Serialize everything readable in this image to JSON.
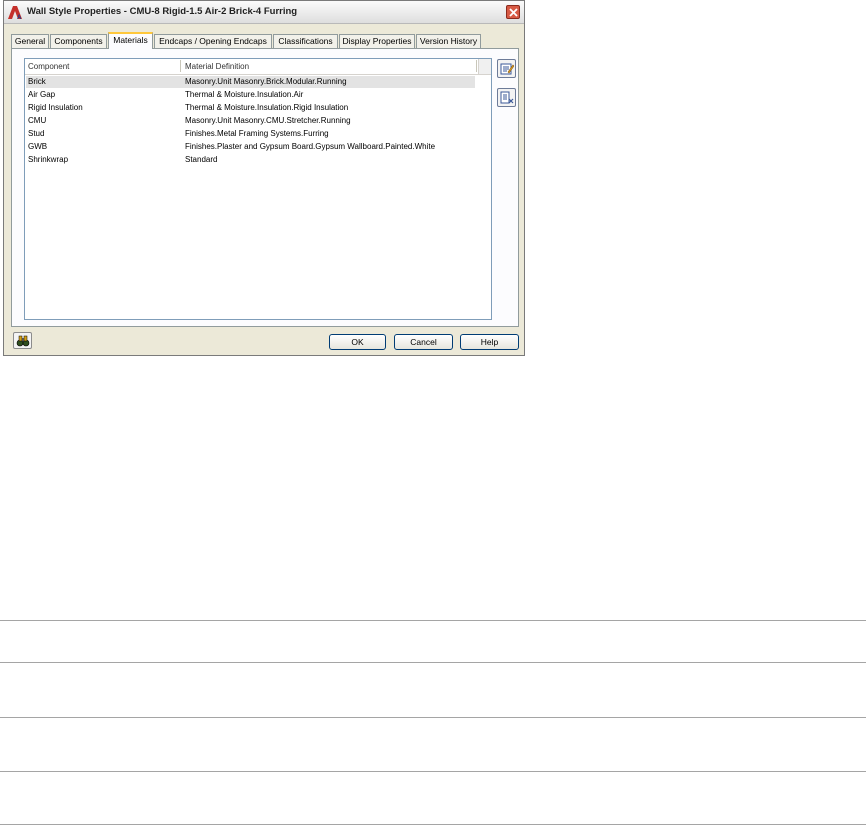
{
  "window": {
    "title": "Wall Style Properties - CMU-8 Rigid-1.5 Air-2 Brick-4 Furring"
  },
  "tabs": [
    {
      "label": "General"
    },
    {
      "label": "Components"
    },
    {
      "label": "Materials",
      "active": true
    },
    {
      "label": "Endcaps / Opening Endcaps"
    },
    {
      "label": "Classifications"
    },
    {
      "label": "Display Properties"
    },
    {
      "label": "Version History"
    }
  ],
  "materials_table": {
    "columns": [
      "Component",
      "Material Definition"
    ],
    "rows": [
      {
        "component": "Brick",
        "material": "Masonry.Unit Masonry.Brick.Modular.Running",
        "selected": true
      },
      {
        "component": "Air Gap",
        "material": "Thermal & Moisture.Insulation.Air"
      },
      {
        "component": "Rigid Insulation",
        "material": "Thermal & Moisture.Insulation.Rigid Insulation"
      },
      {
        "component": "CMU",
        "material": "Masonry.Unit Masonry.CMU.Stretcher.Running"
      },
      {
        "component": "Stud",
        "material": "Finishes.Metal Framing Systems.Furring"
      },
      {
        "component": "GWB",
        "material": "Finishes.Plaster and Gypsum Board.Gypsum Wallboard.Painted.White"
      },
      {
        "component": "Shrinkwrap",
        "material": "Standard"
      }
    ]
  },
  "side_buttons": [
    {
      "icon": "edit-material-icon"
    },
    {
      "icon": "material-tool-icon"
    }
  ],
  "footer": {
    "help_icon": "binoculars-icon",
    "ok_label": "OK",
    "cancel_label": "Cancel",
    "help_label": "Help"
  },
  "colors": {
    "dialog_bg": "#ece9d8",
    "active_tab_accent": "#ffc83c",
    "selected_row": "#e3e3e3",
    "close_button": "#d75a44"
  }
}
